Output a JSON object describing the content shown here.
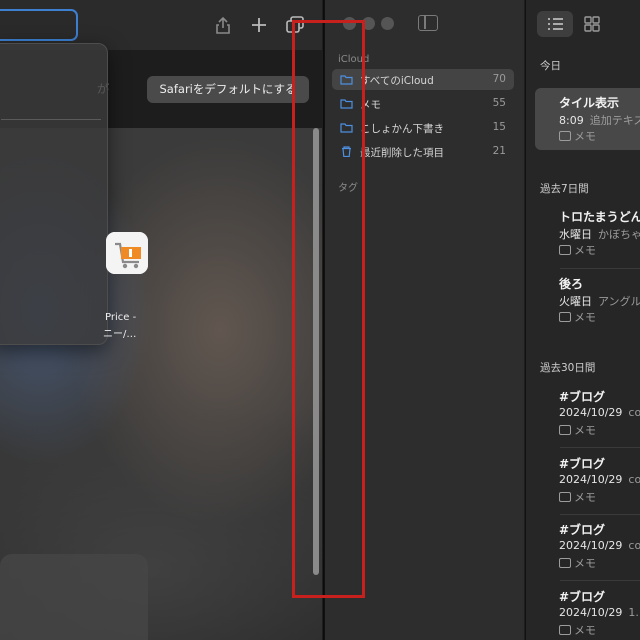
{
  "safari": {
    "banner_text": "が",
    "default_button": "Safariをデフォルトにする",
    "favorite": {
      "label_line1": "Price -",
      "label_line2": "ニー/…",
      "icon": "shopping-cart-icon"
    },
    "toolbar_icons": [
      "share-icon",
      "new-tab-icon",
      "tab-overview-icon"
    ]
  },
  "notes": {
    "sidebar": {
      "section_icloud": "iCloud",
      "folders": [
        {
          "label": "すべてのiCloud",
          "count": "70",
          "selected": true
        },
        {
          "label": "メモ",
          "count": "55"
        },
        {
          "label": "こしょかん下書き",
          "count": "15"
        },
        {
          "label": "最近削除した項目",
          "count": "21"
        }
      ],
      "section_tags": "タグ"
    },
    "list": {
      "groups": {
        "today": "今日",
        "past7": "過去7日間",
        "past30": "過去30日間"
      },
      "items": [
        {
          "title": "タイル表示",
          "date": "8:09",
          "preview": "追加テキス",
          "folder": "メモ",
          "selected": true
        },
        {
          "title": "トロたまうどん",
          "date": "水曜日",
          "preview": "かぼちゃ",
          "folder": "メモ"
        },
        {
          "title": "後ろ",
          "date": "火曜日",
          "preview": "アングル",
          "folder": "メモ"
        },
        {
          "title": "#ブログ",
          "date": "2024/10/29",
          "preview": "co",
          "folder": "メモ"
        },
        {
          "title": "#ブログ",
          "date": "2024/10/29",
          "preview": "co",
          "folder": "メモ"
        },
        {
          "title": "#ブログ",
          "date": "2024/10/29",
          "preview": "co",
          "folder": "メモ"
        },
        {
          "title": "#ブログ",
          "date": "2024/10/29",
          "preview": "1.",
          "folder": "メモ"
        }
      ]
    }
  },
  "colors": {
    "highlight_box": "#c8201c",
    "address_focus": "#3d7fd1",
    "cart_orange": "#f08a24"
  }
}
